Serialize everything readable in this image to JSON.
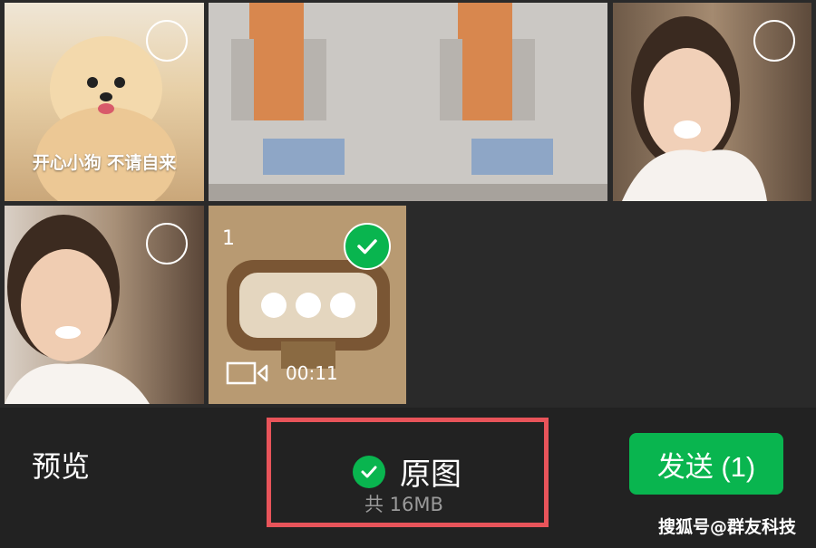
{
  "grid": {
    "dog_photo_caption": "开心小狗 不请自来",
    "selected_item": {
      "order_number": "1",
      "video_duration": "00:11"
    }
  },
  "toolbar": {
    "preview_label": "预览",
    "original_label": "原图",
    "total_size": "共 16MB",
    "send_label": "发送 (1)"
  },
  "watermark": "搜狐号@群友科技",
  "colors": {
    "accent_green": "#09b54f",
    "highlight_box": "#e8545a",
    "toolbar_bg": "#222222"
  }
}
